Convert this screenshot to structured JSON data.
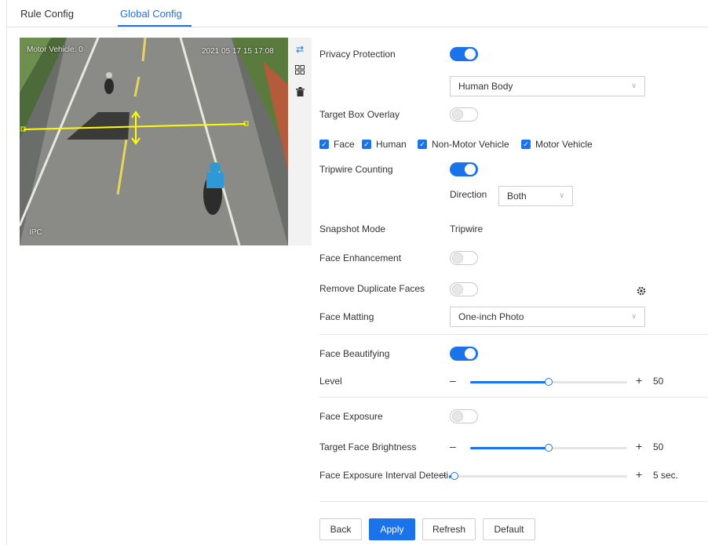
{
  "tabs": [
    {
      "label": "Rule Config"
    },
    {
      "label": "Global Config"
    }
  ],
  "video": {
    "overlay_top_left": "Motor Vehicle: 0",
    "overlay_timestamp": "2021 05 17 15 17:08",
    "overlay_bottom_left": "IPC"
  },
  "video_tools": [
    "move-icon",
    "grid-icon",
    "delete-icon"
  ],
  "settings": {
    "privacy_protection": {
      "label": "Privacy Protection",
      "on": true
    },
    "privacy_target": {
      "value": "Human Body"
    },
    "target_box_overlay": {
      "label": "Target Box Overlay",
      "on": false
    },
    "checkboxes": [
      {
        "label": "Face",
        "checked": true
      },
      {
        "label": "Human",
        "checked": true
      },
      {
        "label": "Non-Motor Vehicle",
        "checked": true
      },
      {
        "label": "Motor Vehicle",
        "checked": true
      }
    ],
    "tripwire_counting": {
      "label": "Tripwire Counting",
      "on": true
    },
    "direction": {
      "label": "Direction",
      "value": "Both"
    },
    "snapshot_mode": {
      "label": "Snapshot Mode",
      "value": "Tripwire"
    },
    "face_enhancement": {
      "label": "Face Enhancement",
      "on": false
    },
    "remove_duplicate_faces": {
      "label": "Remove Duplicate Faces",
      "on": false
    },
    "face_matting": {
      "label": "Face Matting",
      "value": "One-inch Photo"
    },
    "face_beautifying": {
      "label": "Face Beautifying",
      "on": true
    },
    "level": {
      "label": "Level",
      "value": "50",
      "fraction": 0.5
    },
    "face_exposure": {
      "label": "Face Exposure",
      "on": false
    },
    "target_face_brightness": {
      "label": "Target Face Brightness",
      "value": "50",
      "fraction": 0.5
    },
    "face_exposure_interval": {
      "label": "Face Exposure Interval Detecti...",
      "value": "5 sec.",
      "fraction": 0.03
    }
  },
  "slider_controls": {
    "minus": "–",
    "plus": "+"
  },
  "buttons": {
    "back": "Back",
    "apply": "Apply",
    "refresh": "Refresh",
    "default": "Default"
  },
  "colors": {
    "accent": "#1a73e8",
    "tripwire": "#ffff00"
  }
}
